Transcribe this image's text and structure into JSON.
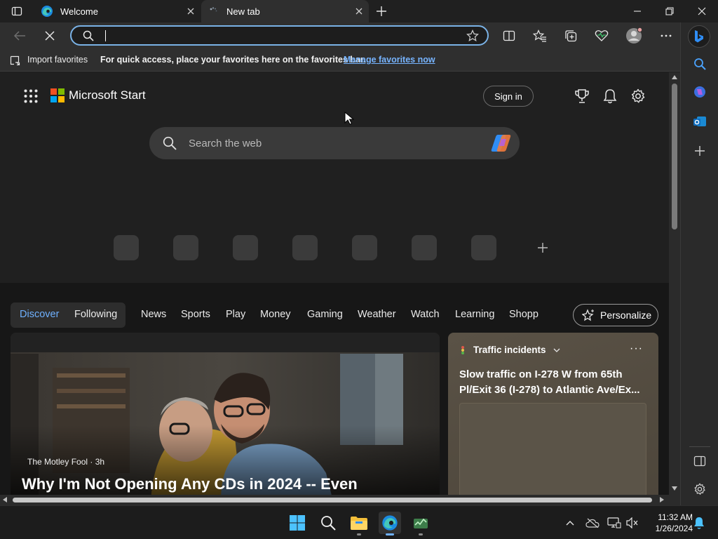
{
  "tabs": [
    {
      "title": "Welcome",
      "active": false
    },
    {
      "title": "New tab",
      "active": true
    }
  ],
  "address_bar": {
    "value": ""
  },
  "favorites_bar": {
    "import_label": "Import favorites",
    "message": "For quick access, place your favorites here on the favorites bar.",
    "link": "Manage favorites now"
  },
  "page": {
    "brand": "Microsoft Start",
    "sign_in": "Sign in",
    "search_placeholder": "Search the web",
    "nav": {
      "discover": "Discover",
      "following": "Following",
      "items": [
        "News",
        "Sports",
        "Play",
        "Money",
        "Gaming",
        "Weather",
        "Watch",
        "Learning",
        "Shopp"
      ],
      "personalize": "Personalize"
    },
    "hero": {
      "source": "The Motley Fool · 3h",
      "title": "Why I'm Not Opening Any CDs in 2024 -- Even"
    },
    "traffic": {
      "header": "Traffic incidents",
      "more": "···",
      "headline": "Slow traffic on I-278 W from 65th Pl/Exit 36 (I-278) to Atlantic Ave/Ex..."
    }
  },
  "taskbar": {
    "time": "11:32 AM",
    "date": "1/26/2024"
  },
  "colors": {
    "accent": "#7ab2e6",
    "link": "#77b4ff",
    "ms_red": "#f25022",
    "ms_green": "#7fba00",
    "ms_blue": "#00a4ef",
    "ms_yellow": "#ffb900"
  }
}
